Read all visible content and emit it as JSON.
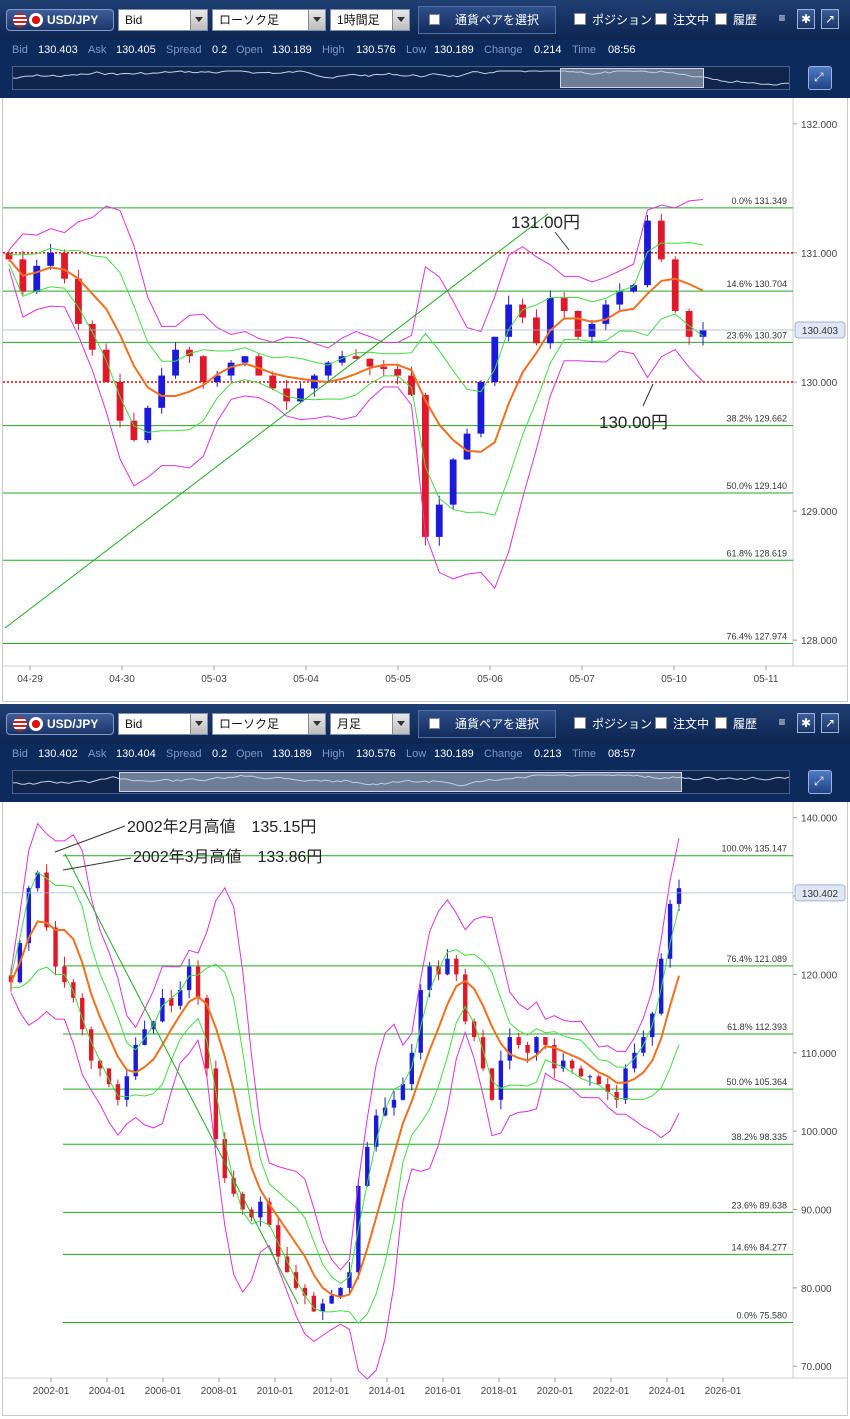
{
  "colors": {
    "toolbar": "#1b3a6e",
    "quote_bar": "#0c2a5c",
    "bullish": "#1a1ad8",
    "bearish": "#e0192a",
    "ma": "#f07020",
    "bb_inner": "#44dd44",
    "bb_outer": "#dd33dd",
    "fibo": "#22aa22",
    "level": "#dd0000",
    "navigator_line": "#c8d2e2"
  },
  "icons": {
    "pair_flags": [
      "us-flag-icon",
      "jp-flag-icon"
    ],
    "dropdown": "chevron-down-icon",
    "menu": "list-icon",
    "settings": "gear-icon",
    "popout": "external-link-icon",
    "navigator": "zoom-out-icon"
  },
  "panels": [
    {
      "toolbar": {
        "pair": "USD/JPY",
        "price_type": "Bid",
        "chart_type": "ローソク足",
        "timeframe": "1時間足",
        "select_pair": "通貨ペアを選択",
        "position": "ポジション",
        "orders": "注文中",
        "history": "履歴"
      },
      "quote": {
        "bid_label": "Bid",
        "bid": "130.403",
        "ask_label": "Ask",
        "ask": "130.405",
        "spread_label": "Spread",
        "spread": "0.2",
        "open_label": "Open",
        "open": "130.189",
        "high_label": "High",
        "high": "130.576",
        "low_label": "Low",
        "low": "130.189",
        "change_label": "Change",
        "change": "0.214",
        "time_label": "Time",
        "time": "08:56"
      },
      "navigator_window": [
        0.705,
        0.89
      ],
      "chart_data": {
        "type": "candlestick",
        "title": "",
        "x_ticks": [
          "04-29",
          "04-30",
          "05-03",
          "05-04",
          "05-05",
          "05-06",
          "05-07",
          "05-10",
          "05-11"
        ],
        "y_ticks": [
          "132.000",
          "131.000",
          "130.000",
          "129.000",
          "128.000"
        ],
        "ylim": [
          127.8,
          132.2
        ],
        "current_price": "130.403",
        "fibonacci": [
          {
            "label": "0.0%",
            "value": "131.349"
          },
          {
            "label": "14.6%",
            "value": "130.704"
          },
          {
            "label": "23.6%",
            "value": "130.307"
          },
          {
            "label": "38.2%",
            "value": "129.662"
          },
          {
            "label": "50.0%",
            "value": "129.140"
          },
          {
            "label": "61.8%",
            "value": "128.619"
          },
          {
            "label": "76.4%",
            "value": "127.974"
          }
        ],
        "level_lines": [
          131.0,
          130.0
        ],
        "annotations": [
          "131.00円",
          "130.00円"
        ],
        "closes": [
          130.95,
          130.7,
          130.9,
          131.0,
          130.8,
          130.45,
          130.25,
          130.0,
          129.7,
          129.55,
          129.8,
          130.05,
          130.25,
          130.2,
          130.0,
          130.05,
          130.15,
          130.2,
          130.05,
          129.95,
          129.85,
          129.95,
          130.05,
          130.15,
          130.2,
          130.18,
          130.12,
          130.1,
          130.05,
          129.9,
          128.8,
          129.05,
          129.4,
          129.6,
          130.0,
          130.35,
          130.6,
          130.5,
          130.3,
          130.65,
          130.55,
          130.35,
          130.45,
          130.6,
          130.7,
          130.75,
          131.25,
          130.95,
          130.55,
          130.35,
          130.4
        ]
      },
      "ylabel_current": "130.403"
    },
    {
      "toolbar": {
        "pair": "USD/JPY",
        "price_type": "Bid",
        "chart_type": "ローソク足",
        "timeframe": "月足",
        "select_pair": "通貨ペアを選択",
        "position": "ポジション",
        "orders": "注文中",
        "history": "履歴"
      },
      "quote": {
        "bid_label": "Bid",
        "bid": "130.402",
        "ask_label": "Ask",
        "ask": "130.404",
        "spread_label": "Spread",
        "spread": "0.2",
        "open_label": "Open",
        "open": "130.189",
        "high_label": "High",
        "high": "130.576",
        "low_label": "Low",
        "low": "130.189",
        "change_label": "Change",
        "change": "0.213",
        "time_label": "Time",
        "time": "08:57"
      },
      "navigator_window": [
        0.136,
        0.862
      ],
      "chart_data": {
        "type": "candlestick",
        "title": "",
        "x_ticks": [
          "2002-01",
          "2004-01",
          "2006-01",
          "2008-01",
          "2010-01",
          "2012-01",
          "2014-01",
          "2016-01",
          "2018-01",
          "2020-01",
          "2022-01",
          "2024-01",
          "2026-01"
        ],
        "y_ticks": [
          "140.000",
          "130.000",
          "120.000",
          "110.000",
          "100.000",
          "90.000",
          "80.000",
          "70.000"
        ],
        "ylim": [
          68.5,
          142
        ],
        "current_price": "130.402",
        "fibonacci": [
          {
            "label": "100.0%",
            "value": "135.147"
          },
          {
            "label": "76.4%",
            "value": "121.089"
          },
          {
            "label": "61.8%",
            "value": "112.393"
          },
          {
            "label": "50.0%",
            "value": "105.364"
          },
          {
            "label": "38.2%",
            "value": "98.335"
          },
          {
            "label": "23.6%",
            "value": "89.638"
          },
          {
            "label": "14.6%",
            "value": "84.277"
          },
          {
            "label": "0.0%",
            "value": "75.580"
          }
        ],
        "annotations": [
          "2002年2月高値　135.15円",
          "2002年3月高値　133.86円"
        ],
        "closes": [
          119,
          124,
          131,
          133,
          126,
          121,
          119,
          117,
          113,
          109,
          108,
          106,
          104,
          107,
          111,
          113,
          114,
          117,
          116,
          118,
          121,
          117,
          108,
          99,
          94,
          92,
          90,
          89,
          91,
          88,
          84,
          82,
          80,
          79,
          77,
          78,
          79,
          80,
          82,
          93,
          98,
          102,
          103,
          104,
          106,
          110,
          118,
          121,
          120,
          122,
          120,
          114,
          112,
          108,
          104,
          109,
          112,
          111,
          110,
          112,
          111,
          108,
          109,
          108,
          107,
          107,
          106,
          105,
          104,
          108,
          110,
          112,
          115,
          122,
          129,
          131
        ]
      },
      "ylabel_current": "130.402"
    }
  ]
}
